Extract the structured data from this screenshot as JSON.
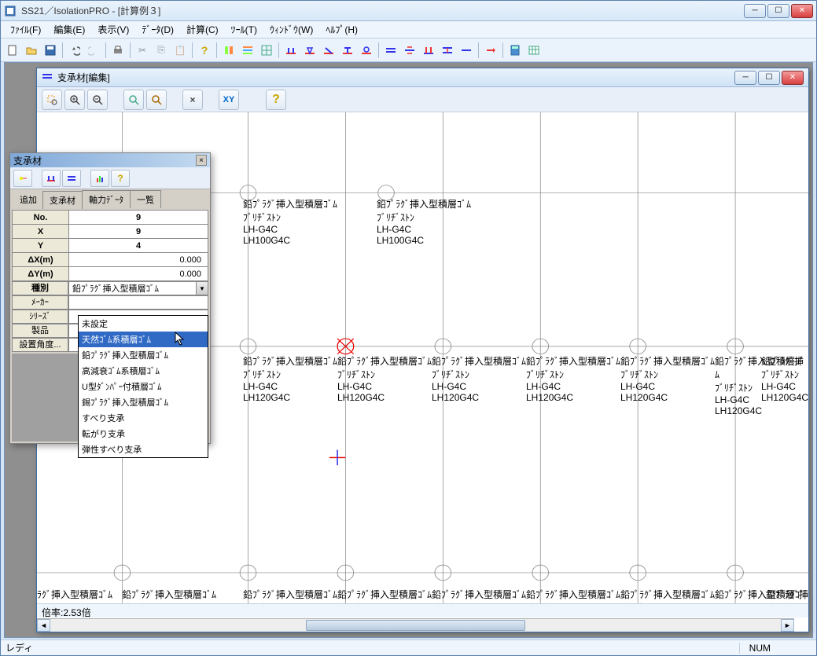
{
  "app": {
    "title": "SS21／IsolationPRO - [計算例３]",
    "inner_title": "支承材[編集]",
    "status_ready": "レディ",
    "status_num": "NUM",
    "zoom": "倍率:2.53倍"
  },
  "menu": [
    "ﾌｧｲﾙ(F)",
    "編集(E)",
    "表示(V)",
    "ﾃﾞｰﾀ(D)",
    "計算(C)",
    "ﾂｰﾙ(T)",
    "ｳｨﾝﾄﾞｳ(W)",
    "ﾍﾙﾌﾟ(H)"
  ],
  "panel": {
    "title": "支承材",
    "tab_add": "追加",
    "tab_shou": "支承材",
    "tab_axis": "軸力ﾃﾞｰﾀ",
    "tab_list": "一覧",
    "rows": {
      "no_label": "No.",
      "no_val": "9",
      "x_label": "X",
      "x_val": "9",
      "y_label": "Y",
      "y_val": "4",
      "dx_label": "ΔX(m)",
      "dx_val": "0.000",
      "dy_label": "ΔY(m)",
      "dy_val": "0.000",
      "type_label": "種別",
      "type_val": "鉛ﾌﾟﾗｸﾞ挿入型積層ｺﾞﾑ",
      "maker_label": "ﾒｰｶｰ",
      "series_label": "ｼﾘｰｽﾞ",
      "product_label": "製品",
      "angle_label": "設置角度..."
    }
  },
  "dropdown": {
    "items": [
      "未設定",
      "天然ｺﾞﾑ系積層ｺﾞﾑ",
      "鉛ﾌﾟﾗｸﾞ挿入型積層ｺﾞﾑ",
      "高減衰ｺﾞﾑ系積層ｺﾞﾑ",
      "U型ﾀﾞﾝﾊﾟｰ付積層ｺﾞﾑ",
      "錫ﾌﾟﾗｸﾞ挿入型積層ｺﾞﾑ",
      "すべり支承",
      "転がり支承",
      "弾性すべり支承"
    ],
    "selected_index": 1
  },
  "nodes": {
    "label_type": "鉛ﾌﾟﾗｸﾞ挿入型積層ｺﾞﾑ",
    "label_maker": "ﾌﾞﾘﾁﾞｽﾄﾝ",
    "label_series": "LH-G4C",
    "label_model_100": "LH100G4C",
    "label_model_120": "LH120G4C"
  }
}
